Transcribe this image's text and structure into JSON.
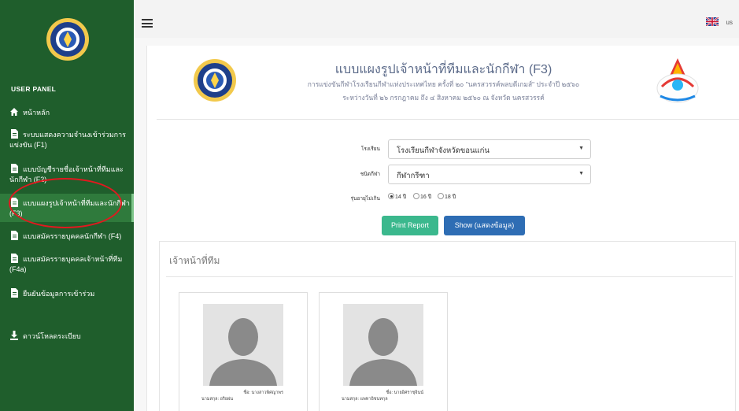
{
  "sidebar": {
    "panel_title": "USER PANEL",
    "items": [
      {
        "label": "หน้าหลัก"
      },
      {
        "label": "ระบบแสดงความจำนงเข้าร่วมการแข่งขัน (F1)"
      },
      {
        "label": "แบบบัญชีรายชื่อเจ้าหน้าที่ทีมและนักกีฬา (F2)"
      },
      {
        "label": "แบบแผงรูปเจ้าหน้าที่ทีมและนักกีฬา (F3)"
      },
      {
        "label": "แบบสมัครรายบุคคลนักกีฬา (F4)"
      },
      {
        "label": "แบบสมัครรายบุคคลเจ้าหน้าที่ทีม (F4a)"
      },
      {
        "label": "ยืนยันข้อมูลการเข้าร่วม"
      },
      {
        "label": "ดาวน์โหลดระเบียบ"
      }
    ]
  },
  "topbar": {
    "lang": "us"
  },
  "header": {
    "title": "แบบแผงรูปเจ้าหน้าที่ทีมและนักกีฬา (F3)",
    "subtitle": "การแข่งขันกีฬาโรงเรียนกีฬาแห่งประเทศไทย ครั้งที่ ๒๐ \"นครสวรรค์พลบดีเกมส์\" ประจำปี ๒๕๖๐",
    "subtitle2": "ระหว่างวันที่ ๒๖ กรกฎาคม ถึง ๔ สิงหาคม ๒๕๖๐ ณ จังหวัด นครสวรรค์"
  },
  "form": {
    "school_label": "โรงเรียน",
    "school_value": "โรงเรียนกีฬาจังหวัดขอนแก่น",
    "sport_label": "ชนิดกีฬา",
    "sport_value": "กีฬากรีฑา",
    "age_label": "รุ่นอายุไม่เกิน",
    "age_options": [
      {
        "label": "14 ปี",
        "selected": true
      },
      {
        "label": "16 ปี",
        "selected": false
      },
      {
        "label": "18 ปี",
        "selected": false
      }
    ],
    "print_label": "Print Report",
    "show_label": "Show (แสดงข้อมูล)"
  },
  "team": {
    "heading": "เจ้าหน้าที่ทีม",
    "members": [
      {
        "name": "ชื่อ:  นางสาวพิศญาพร",
        "surname": "นามสกุล:  อริยผ่น"
      },
      {
        "name": "ชื่อ:  นายอิศราชุจินน์",
        "surname": "นามสกุล:  แพทาอิชนทกุล"
      }
    ]
  },
  "colors": {
    "sidebar": "#1f5e2c",
    "active_item": "#2f7a3c",
    "highlight_circle": "#e0191f",
    "print_button": "#3bb88d",
    "show_button": "#2e6db4",
    "title_text": "#5c6b8a"
  }
}
